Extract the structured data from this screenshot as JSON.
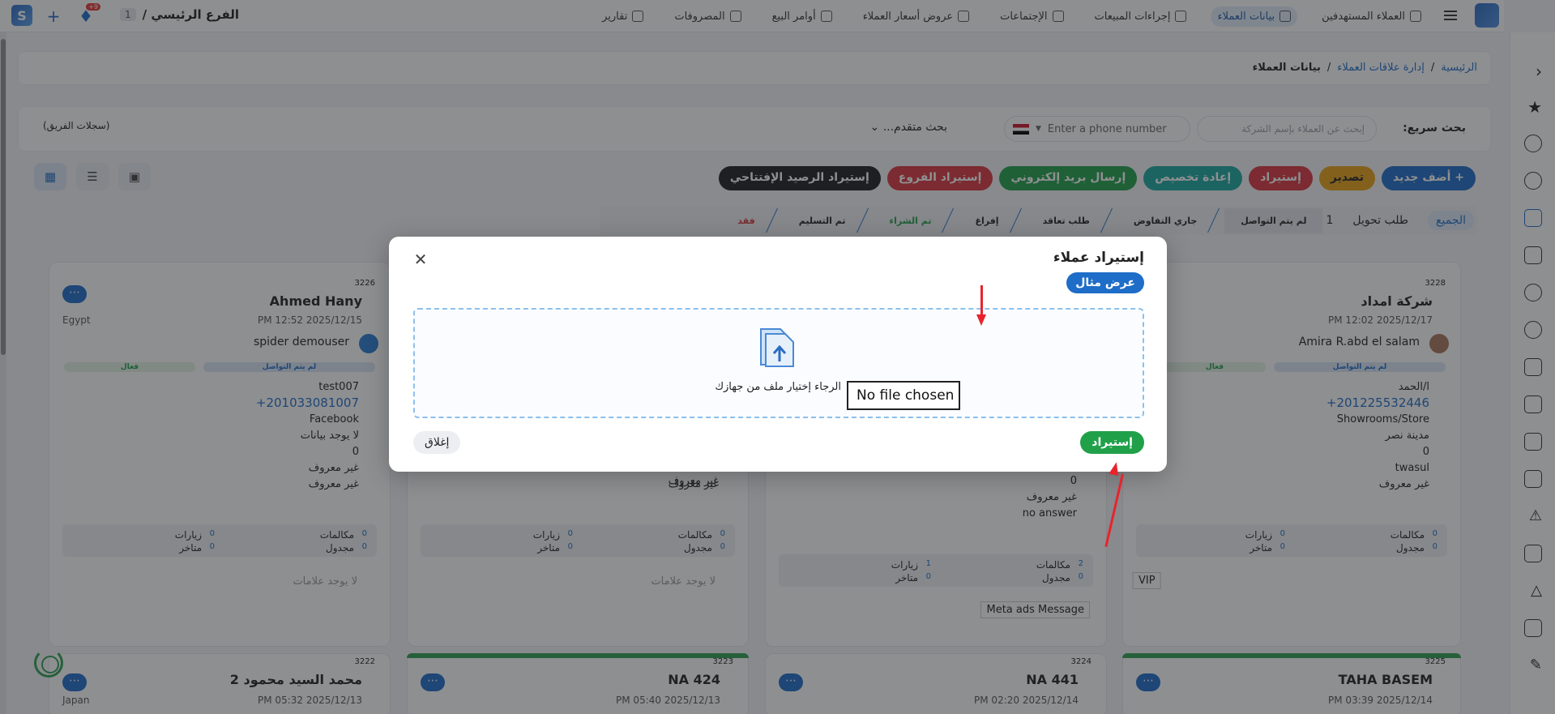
{
  "topbar": {
    "branch_label": "الفرع الرئيسي /",
    "branch_count": "1",
    "notif_badge": "+9",
    "nav": [
      {
        "label": "العملاء المستهدفين",
        "icon": "target-customers-icon"
      },
      {
        "label": "بيانات العملاء",
        "icon": "customer-data-icon",
        "active": true
      },
      {
        "label": "إجراءات المبيعات",
        "icon": "phone-icon"
      },
      {
        "label": "الإجتماعات",
        "icon": "meeting-icon"
      },
      {
        "label": "عروض أسعار العملاء",
        "icon": "quote-icon"
      },
      {
        "label": "أوامر البيع",
        "icon": "sales-order-icon"
      },
      {
        "label": "المصروفات",
        "icon": "expenses-icon"
      },
      {
        "label": "تقارير",
        "icon": "reports-icon"
      }
    ]
  },
  "breadcrumb": {
    "home": "الرئيسية",
    "sep": "/",
    "crm": "إدارة علاقات العملاء",
    "current": "بيانات العملاء"
  },
  "search": {
    "quick_label": "بحث سريع:",
    "company_placeholder": "إبحث عن العملاء بإسم الشركة",
    "phone_placeholder": "Enter a phone number",
    "advanced": "بحث متقدم...",
    "team_records": "(سجلات الفريق)"
  },
  "actions": {
    "add_new": "+ أضف جديد",
    "export": "تصدير",
    "import": "إستيراد",
    "reassign": "إعادة تخصيص",
    "send_email": "إرسال بريد إلكتروني",
    "import_branches": "إستيراد الفروع",
    "import_opening_balance": "إستيراد الرصيد الإفتتاحي"
  },
  "colors": {
    "blue": "#1e6dc8",
    "orange": "#e8a317",
    "red": "#d9363e",
    "teal": "#1ba8a0",
    "green": "#21a04a",
    "dark": "#1d1f23"
  },
  "stages": {
    "all": "الجميع",
    "transfer_request": "طلب تحويل",
    "transfer_count": "1",
    "not_contacted": "لم يتم التواصل",
    "negotiating": "جاري التفاوض",
    "contract_request": "طلب تعاقد",
    "unloading": "إفراغ",
    "purchased": "تم الشراء",
    "delivered": "تم التسليم",
    "lost": "فقد"
  },
  "cards_row1": [
    {
      "id": "3228",
      "name": "شركة امداد",
      "datetime": "PM 12:02 2025/12/17",
      "owner": "Amira R.abd el salam",
      "status": "لم يتم التواصل",
      "active": "فعال",
      "contact": "ا/الحمد",
      "phone": "201225532446+",
      "source": "Showrooms/Store",
      "location": "مدينة نصر",
      "rating": "0",
      "field1": "twasul",
      "field2": "غير معروف",
      "calls_label": "مكالمات",
      "calls": "0",
      "visits_label": "زيارات",
      "visits": "0",
      "scheduled_label": "مجدول",
      "scheduled": "0",
      "late_label": "متاخر",
      "late": "0",
      "tag": "VIP"
    },
    {
      "id": "",
      "name": "",
      "datetime": "",
      "owner": "",
      "rating": "0",
      "field1": "غير معروف",
      "field2": "no answer",
      "calls_label": "مكالمات",
      "calls": "2",
      "visits_label": "زيارات",
      "visits": "1",
      "scheduled_label": "مجدول",
      "scheduled": "0",
      "late_label": "متاخر",
      "late": "0",
      "tag": "Meta ads Message"
    },
    {
      "id": "",
      "field1": "غير معروف",
      "field2": "غير معروف",
      "calls_label": "مكالمات",
      "calls": "0",
      "visits_label": "زيارات",
      "visits": "0",
      "scheduled_label": "مجدول",
      "scheduled": "0",
      "late_label": "متاخر",
      "late": "0",
      "no_tags": "لا يوجد علامات"
    },
    {
      "id": "3226",
      "name": "Ahmed Hany",
      "datetime": "PM 12:52 2025/12/15",
      "country": "Egypt",
      "owner": "spider demouser",
      "status": "لم يتم التواصل",
      "active": "فعال",
      "contact": "test007",
      "phone": "201033081007+",
      "source": "Facebook",
      "location": "لا يوجد بيانات",
      "rating": "0",
      "field1": "غير معروف",
      "field2": "غير معروف",
      "calls_label": "مكالمات",
      "calls": "0",
      "visits_label": "زيارات",
      "visits": "0",
      "scheduled_label": "مجدول",
      "scheduled": "0",
      "late_label": "متاخر",
      "late": "0",
      "no_tags": "لا يوجد علامات"
    }
  ],
  "cards_row2": [
    {
      "id": "3225",
      "name": "TAHA BASEM",
      "datetime": "PM 03:39 2025/12/14"
    },
    {
      "id": "3224",
      "name": "NA 441",
      "datetime": "PM 02:20 2025/12/14"
    },
    {
      "id": "3223",
      "name": "NA 424",
      "datetime": "PM 05:40 2025/12/13"
    },
    {
      "id": "3222",
      "name": "محمد السيد محمود 2",
      "datetime": "PM 05:32 2025/12/13",
      "country": "Japan"
    }
  ],
  "modal": {
    "title": "إستيراد عملاء",
    "example_button": "عرض مثال",
    "drop_text": "الرجاء إختيار ملف من جهازك",
    "file_status": "No file chosen",
    "import_button": "إستيراد",
    "close_button": "إغلاق"
  }
}
